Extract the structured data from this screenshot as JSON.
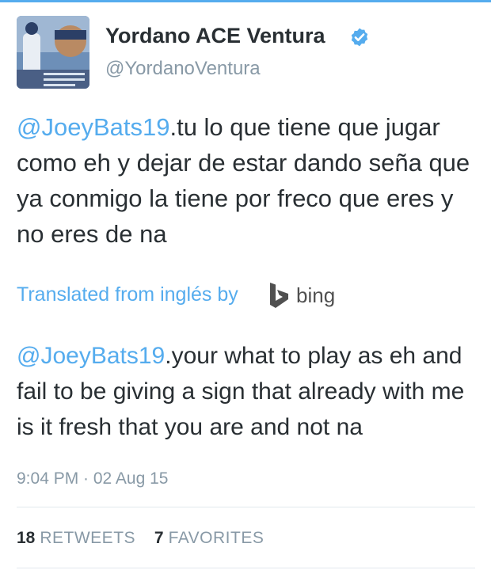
{
  "author": {
    "display_name": "Yordano ACE Ventura",
    "handle": "@YordanoVentura",
    "verified": true,
    "avatar_icon": "avatar-photo-baseball-player"
  },
  "tweet": {
    "mention": "@JoeyBats19",
    "text": ".tu lo que tiene que jugar como eh y dejar de estar dando seña que ya conmigo la tiene por freco que eres y no eres de na"
  },
  "translation": {
    "label": "Translated from inglés by",
    "provider": "bing",
    "mention": "@JoeyBats19",
    "text": ".your what to play as eh and fail to be giving a sign that already with me is it fresh that you are and not na"
  },
  "timestamp": "9:04 PM · 02 Aug 15",
  "stats": [
    {
      "count": "18",
      "label": "RETWEETS"
    },
    {
      "count": "7",
      "label": "FAVORITES"
    }
  ],
  "colors": {
    "accent": "#55acee",
    "text": "#292f33",
    "muted": "#8899a6"
  }
}
